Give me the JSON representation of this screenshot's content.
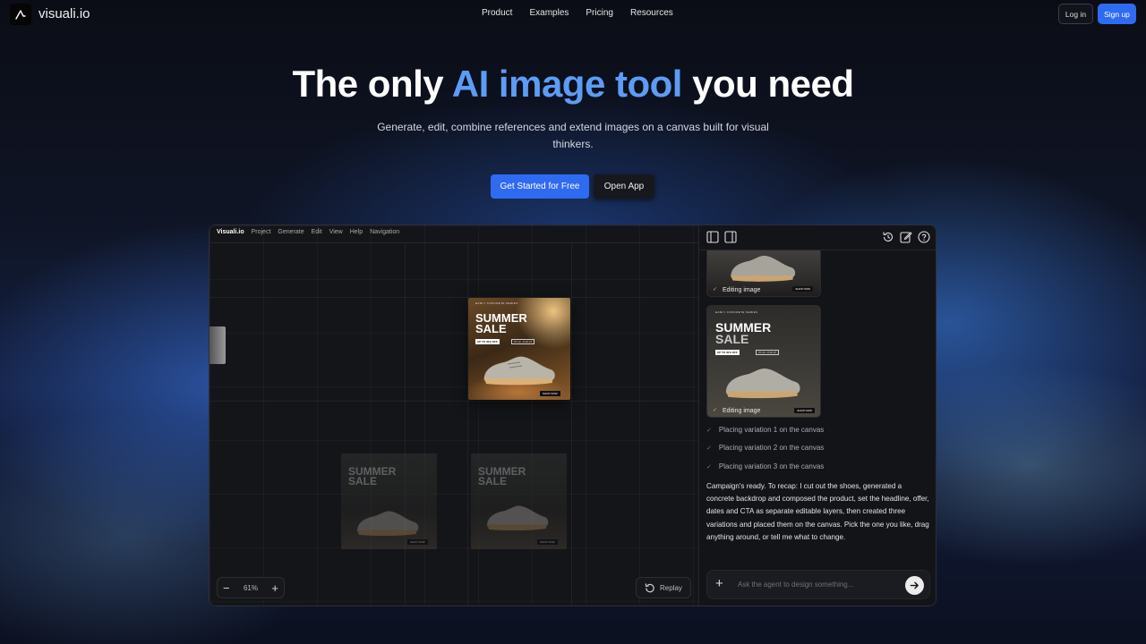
{
  "nav": {
    "logo_text": "visuali.io",
    "links": [
      "Product",
      "Examples",
      "Pricing",
      "Resources"
    ],
    "login_label": "Log in",
    "signup_label": "Sign up"
  },
  "hero": {
    "title_pre": "The only ",
    "title_accent": "AI image tool",
    "title_post": " you need",
    "subtitle": "Generate, edit, combine references and extend images on a canvas built for visual thinkers.",
    "primary_cta": "Get Started for Free",
    "secondary_cta": "Open App"
  },
  "app": {
    "menubar": {
      "brand": "Visuali.io",
      "items": [
        "Project",
        "Generate",
        "Edit",
        "View",
        "Help",
        "Navigation"
      ]
    },
    "poster": {
      "subtitle": "EARLY CONCRETE SERIES",
      "title_line1": "SUMMER",
      "title_line2": "SALE",
      "offer": "UP TO 40% OFF",
      "dates": "07.12 - 8.10.27",
      "cta": "SHOP NOW"
    },
    "zoom": {
      "minus": "−",
      "level": "61%",
      "plus": "+"
    },
    "replay_label": "Replay",
    "panel": {
      "cards": [
        {
          "label": "Editing image",
          "check": "✓"
        },
        {
          "label": "Editing image",
          "check": "✓"
        }
      ],
      "steps": [
        "Placing variation 1 on the canvas",
        "Placing variation 2 on the canvas",
        "Placing variation 3 on the canvas"
      ],
      "step_check": "✓",
      "recap": "Campaign's ready. To recap: I cut out the shoes, generated a concrete backdrop and composed the product, set the headline, offer, dates and CTA as separate editable layers, then created three variations and placed them on the canvas. Pick the one you like, drag anything around, or tell me what to change.",
      "input_placeholder": "Ask the agent to design something...",
      "input_plus": "+"
    }
  },
  "colors": {
    "accent": "#5d9cf5",
    "primary_button": "#2f6bf0",
    "app_background": "#131418"
  }
}
